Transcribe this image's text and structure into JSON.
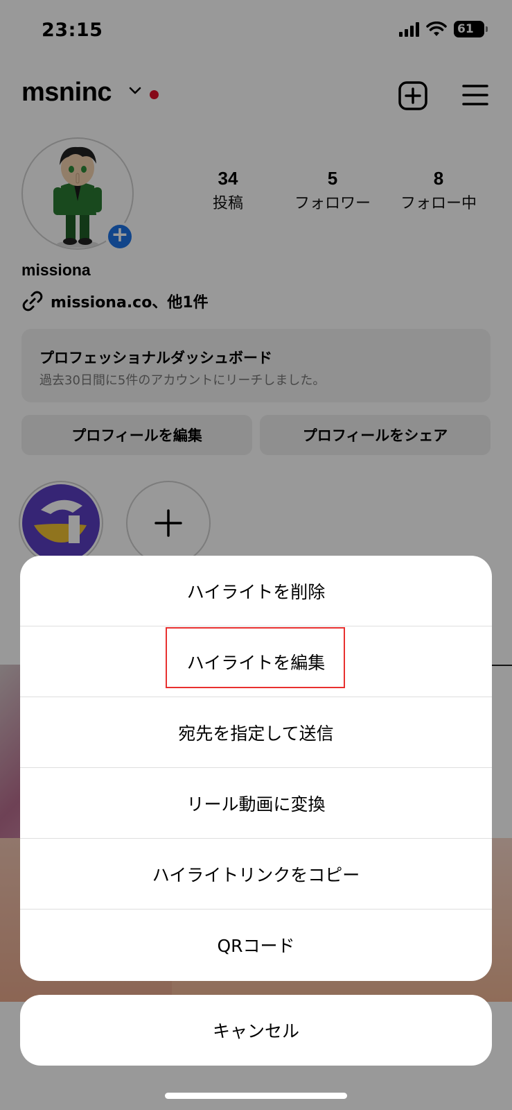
{
  "status_bar": {
    "time": "23:15",
    "battery": "61"
  },
  "header": {
    "username": "msninc"
  },
  "profile": {
    "stats": [
      {
        "value": "34",
        "label": "投稿"
      },
      {
        "value": "5",
        "label": "フォロワー"
      },
      {
        "value": "8",
        "label": "フォロー中"
      }
    ],
    "display_name": "missiona",
    "link": "missiona.co、他1件"
  },
  "dashboard": {
    "title": "プロフェッショナルダッシュボード",
    "subtitle": "過去30日間に5件のアカウントにリーチしました。"
  },
  "buttons": {
    "edit_profile": "プロフィールを編集",
    "share_profile": "プロフィールをシェア"
  },
  "action_sheet": {
    "items": [
      "ハイライトを削除",
      "ハイライトを編集",
      "宛先を指定して送信",
      "リール動画に変換",
      "ハイライトリンクをコピー",
      "QRコード"
    ],
    "cancel": "キャンセル"
  },
  "colors": {
    "notification_dot": "#e0102b",
    "avatar_plus_badge": "#1d74e6",
    "annotation_box": "#e8302f"
  }
}
